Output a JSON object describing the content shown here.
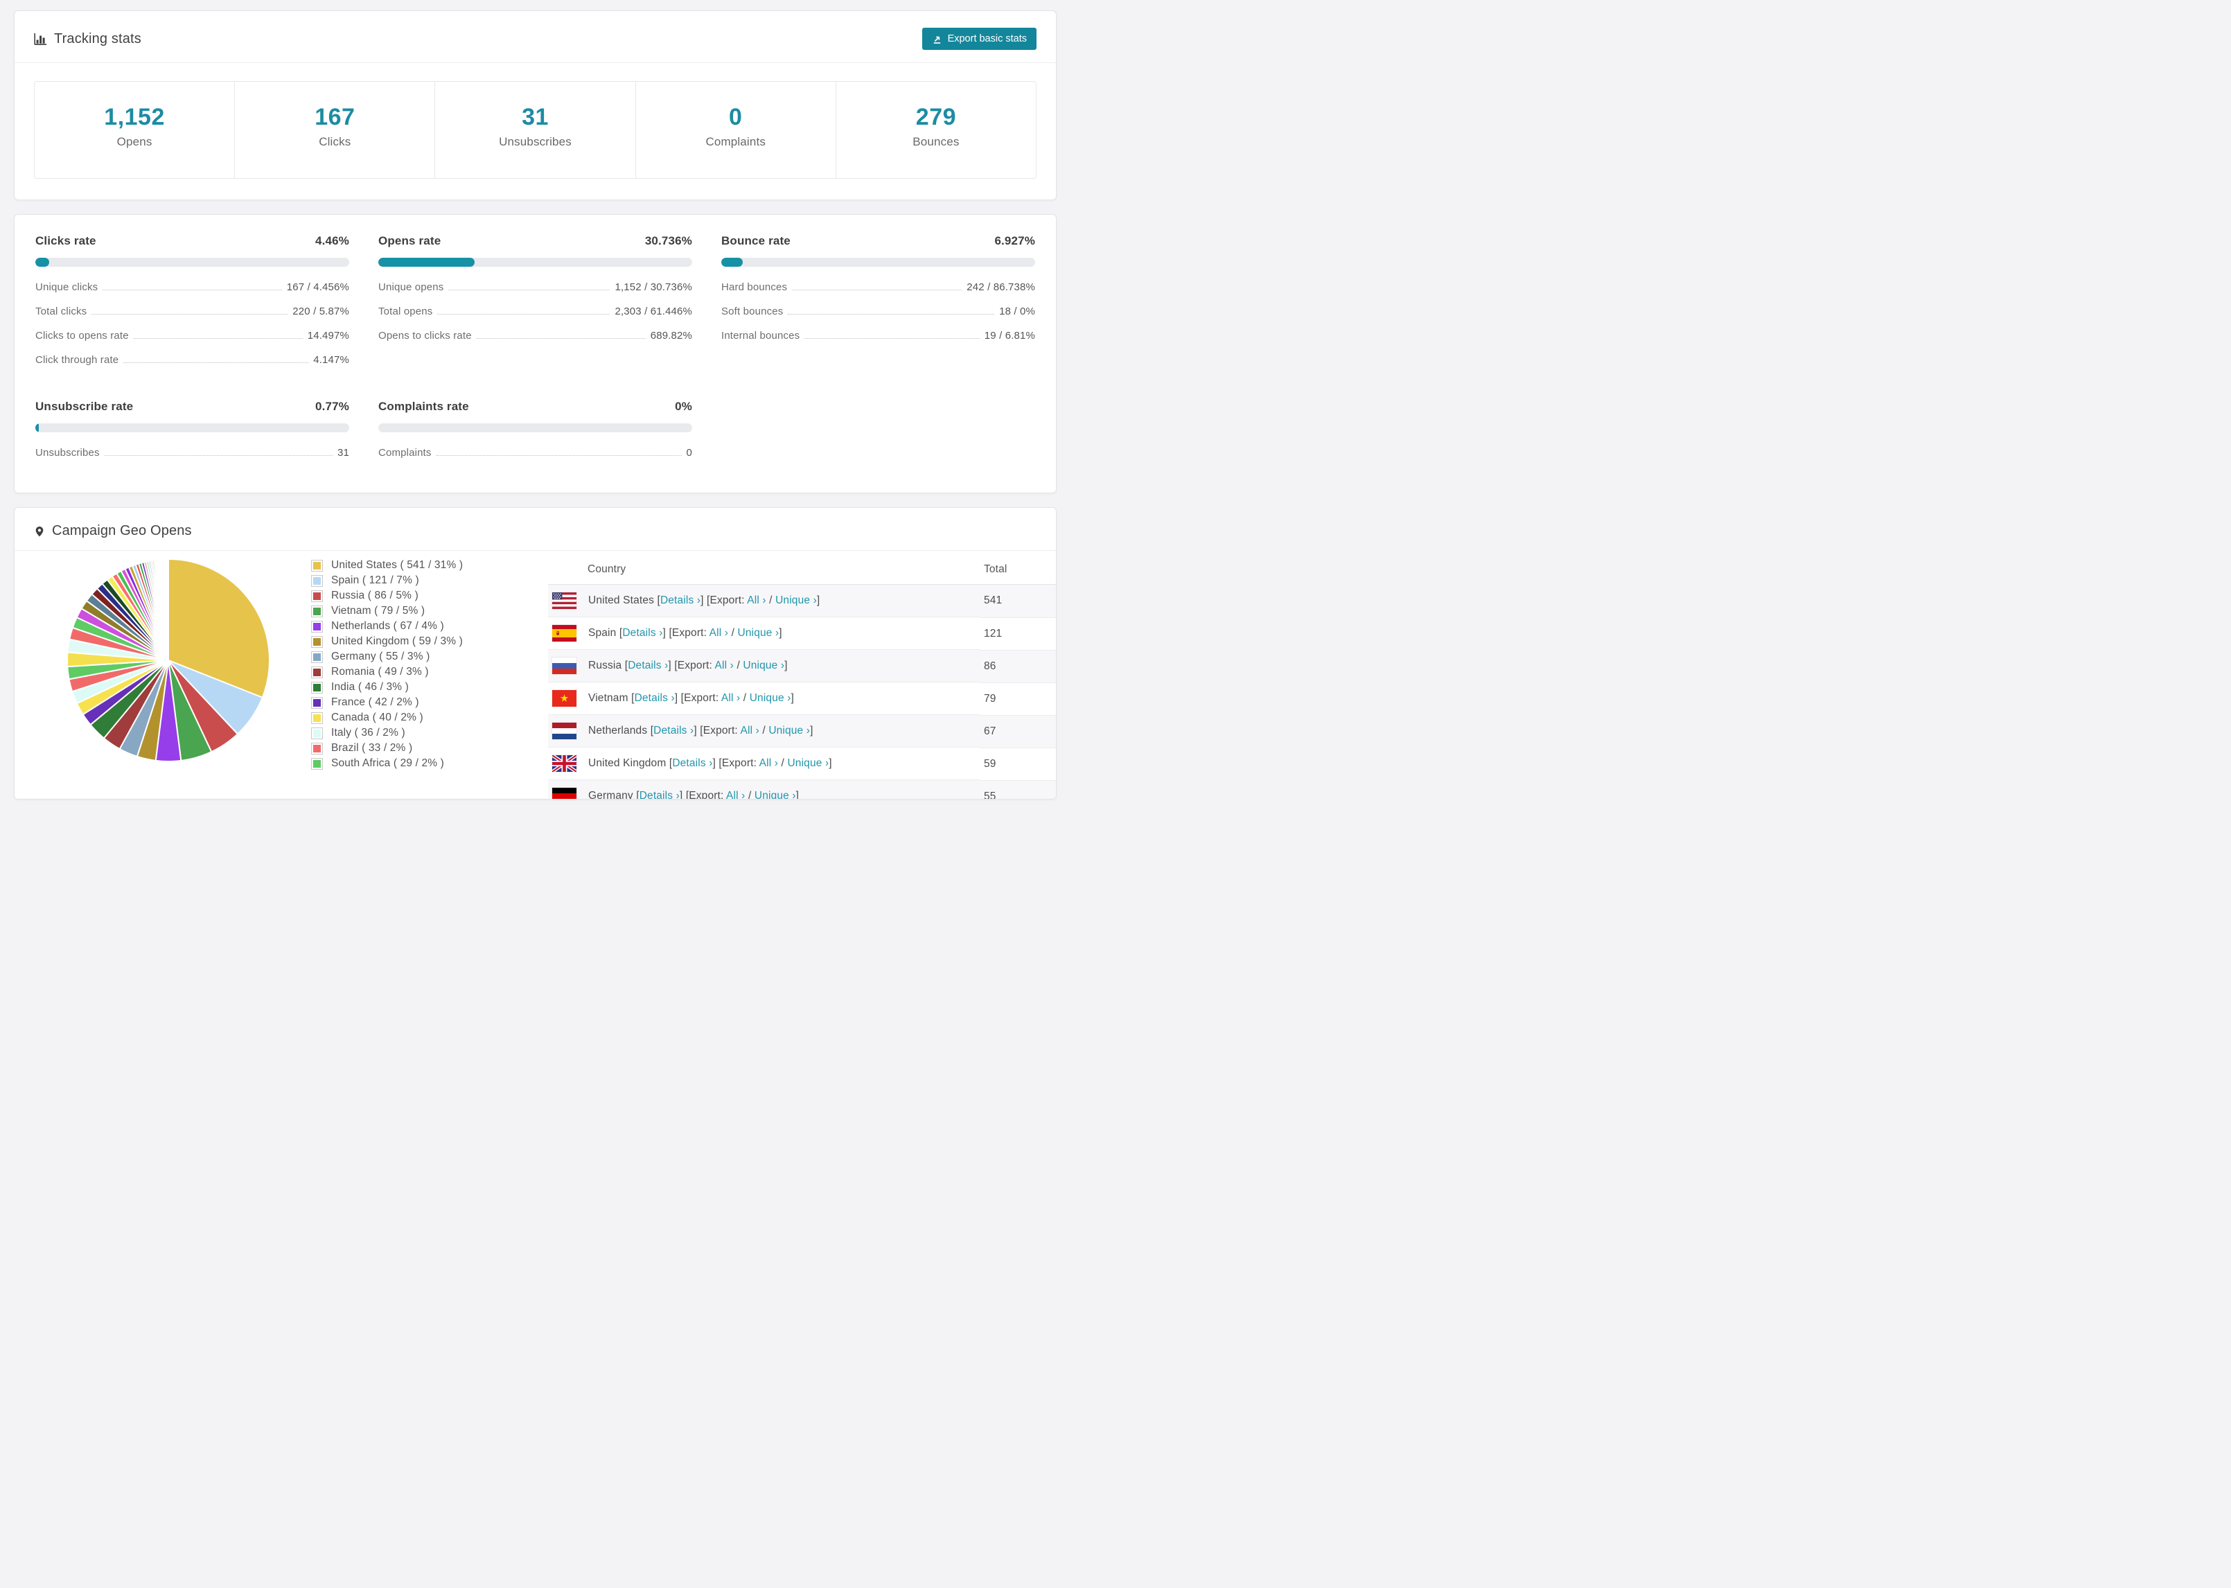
{
  "colors": {
    "accent": "#1b8ca3",
    "button": "#13869b",
    "link": "#2196ac",
    "progress_fill": "#1691a5",
    "row_stripe": "#f7f7f9"
  },
  "header": {
    "title": "Tracking stats",
    "export_label": "Export basic stats"
  },
  "stats": [
    {
      "value": "1,152",
      "label": "Opens"
    },
    {
      "value": "167",
      "label": "Clicks"
    },
    {
      "value": "31",
      "label": "Unsubscribes"
    },
    {
      "value": "0",
      "label": "Complaints"
    },
    {
      "value": "279",
      "label": "Bounces"
    }
  ],
  "rates": [
    {
      "title": "Clicks rate",
      "value": "4.46%",
      "percent": 4.46,
      "rows": [
        {
          "label": "Unique clicks",
          "value": "167 / 4.456%"
        },
        {
          "label": "Total clicks",
          "value": "220 / 5.87%"
        },
        {
          "label": "Clicks to opens rate",
          "value": "14.497%"
        },
        {
          "label": "Click through rate",
          "value": "4.147%"
        }
      ]
    },
    {
      "title": "Opens rate",
      "value": "30.736%",
      "percent": 30.736,
      "rows": [
        {
          "label": "Unique opens",
          "value": "1,152 / 30.736%"
        },
        {
          "label": "Total opens",
          "value": "2,303 / 61.446%"
        },
        {
          "label": "Opens to clicks rate",
          "value": "689.82%"
        }
      ]
    },
    {
      "title": "Bounce rate",
      "value": "6.927%",
      "percent": 6.927,
      "rows": [
        {
          "label": "Hard bounces",
          "value": "242 / 86.738%"
        },
        {
          "label": "Soft bounces",
          "value": "18 / 0%"
        },
        {
          "label": "Internal bounces",
          "value": "19 / 6.81%"
        }
      ]
    },
    {
      "title": "Unsubscribe rate",
      "value": "0.77%",
      "percent": 0.77,
      "rows": [
        {
          "label": "Unsubscribes",
          "value": "31"
        }
      ]
    },
    {
      "title": "Complaints rate",
      "value": "0%",
      "percent": 0,
      "rows": [
        {
          "label": "Complaints",
          "value": "0"
        }
      ]
    }
  ],
  "chart_data": {
    "type": "pie",
    "title": "Campaign Geo Opens",
    "legend_position": "right",
    "start_angle_deg": -90,
    "direction": "clockwise",
    "slices": [
      {
        "label": "United States",
        "value": 541,
        "pct": 31,
        "color": "#e6c34a"
      },
      {
        "label": "Spain",
        "value": 121,
        "pct": 7,
        "color": "#b6d8f4"
      },
      {
        "label": "Russia",
        "value": 86,
        "pct": 5,
        "color": "#c94d4d"
      },
      {
        "label": "Vietnam",
        "value": 79,
        "pct": 5,
        "color": "#4aa550"
      },
      {
        "label": "Netherlands",
        "value": 67,
        "pct": 4,
        "color": "#963ee9"
      },
      {
        "label": "United Kingdom",
        "value": 59,
        "pct": 3,
        "color": "#b3922e"
      },
      {
        "label": "Germany",
        "value": 55,
        "pct": 3,
        "color": "#87a7c3"
      },
      {
        "label": "Romania",
        "value": 49,
        "pct": 3,
        "color": "#a03c3c"
      },
      {
        "label": "India",
        "value": 46,
        "pct": 3,
        "color": "#2f7d36"
      },
      {
        "label": "France",
        "value": 42,
        "pct": 2,
        "color": "#6730b8"
      },
      {
        "label": "Canada",
        "value": 40,
        "pct": 2,
        "color": "#f8e14e"
      },
      {
        "label": "Italy",
        "value": 36,
        "pct": 2,
        "color": "#dcfbf6"
      },
      {
        "label": "Brazil",
        "value": 33,
        "pct": 2,
        "color": "#f16a6a"
      },
      {
        "label": "South Africa",
        "value": 29,
        "pct": 2,
        "color": "#5ecb64"
      }
    ],
    "others_pct": 26,
    "tail_palette": [
      "#f4e04e",
      "#e0fbf6",
      "#f16a6a",
      "#5ecb64",
      "#cc4fe0",
      "#8f7d2a",
      "#5d7f95",
      "#7d2222",
      "#2a2e85",
      "#1c4a22",
      "#f2ee4f",
      "#fa6e6e",
      "#46c14e",
      "#e04fd0",
      "#8a2be2",
      "#c9a22e",
      "#a8cdf0",
      "#e05252",
      "#3a9e42",
      "#6a2fb5",
      "#ef9fb7",
      "#8fefa3",
      "#b9b9ef",
      "#efd0a0",
      "#46b9c9"
    ]
  },
  "geo": {
    "title": "Campaign Geo Opens",
    "table": {
      "columns": [
        "Country",
        "Total"
      ],
      "links": {
        "details": "Details ›",
        "export_prefix": "Export:",
        "all": "All ›",
        "unique": "Unique ›"
      },
      "rows": [
        {
          "country": "United States",
          "total": "541",
          "flag": "us"
        },
        {
          "country": "Spain",
          "total": "121",
          "flag": "es"
        },
        {
          "country": "Russia",
          "total": "86",
          "flag": "ru"
        },
        {
          "country": "Vietnam",
          "total": "79",
          "flag": "vn"
        },
        {
          "country": "Netherlands",
          "total": "67",
          "flag": "nl"
        },
        {
          "country": "United Kingdom",
          "total": "59",
          "flag": "gb"
        },
        {
          "country": "Germany",
          "total": "55",
          "flag": "de",
          "clipped": true
        }
      ]
    }
  }
}
